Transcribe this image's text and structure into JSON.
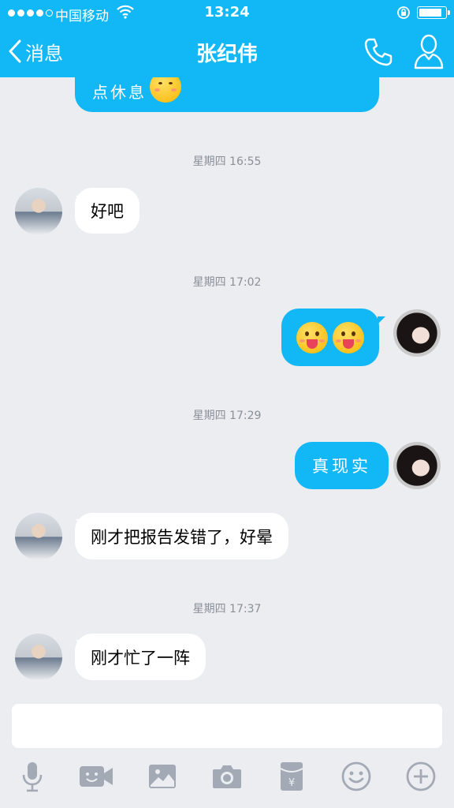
{
  "status_bar": {
    "carrier": "中国移动",
    "time": "13:24"
  },
  "nav": {
    "back_label": "消息",
    "title": "张纪伟"
  },
  "messages": [
    {
      "type": "partial",
      "text": "点休息"
    },
    {
      "type": "timestamp",
      "text": "星期四 16:55"
    },
    {
      "type": "in",
      "text": "好吧"
    },
    {
      "type": "timestamp",
      "text": "星期四 17:02"
    },
    {
      "type": "out-emoji",
      "emoji": [
        "tongue-face-icon",
        "tongue-face-icon"
      ]
    },
    {
      "type": "timestamp",
      "text": "星期四 17:29"
    },
    {
      "type": "out",
      "text": "真现实"
    },
    {
      "type": "in",
      "text": "刚才把报告发错了，好晕"
    },
    {
      "type": "timestamp",
      "text": "星期四 17:37"
    },
    {
      "type": "in",
      "text": "刚才忙了一阵"
    }
  ],
  "toolbar": [
    "microphone-icon",
    "video-call-icon",
    "image-icon",
    "camera-icon",
    "red-packet-icon",
    "emoji-icon",
    "plus-icon"
  ],
  "colors": {
    "accent": "#12b7f5",
    "background": "#ebedf1",
    "incoming_bubble": "#ffffff"
  }
}
